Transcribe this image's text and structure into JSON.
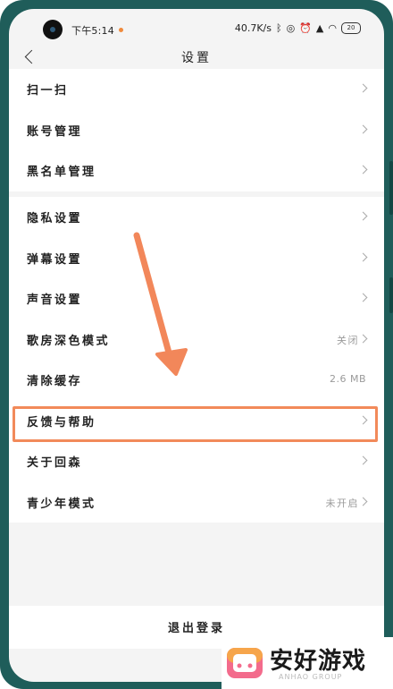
{
  "status_bar": {
    "time": "下午5:14",
    "network_speed": "40.7K/s",
    "icons": [
      "bluetooth-icon",
      "headset-icon",
      "alarm-icon",
      "cellular-signal-icon",
      "wifi-icon"
    ],
    "battery": "20"
  },
  "header": {
    "title": "设置"
  },
  "group1": [
    {
      "label": "扫一扫"
    },
    {
      "label": "账号管理"
    },
    {
      "label": "黑名单管理"
    }
  ],
  "group2": [
    {
      "label": "隐私设置"
    },
    {
      "label": "弹幕设置"
    },
    {
      "label": "声音设置"
    },
    {
      "label": "歌房深色模式",
      "value": "关闭"
    },
    {
      "label": "清除缓存",
      "value": "2.6 MB"
    },
    {
      "label": "反馈与帮助",
      "highlighted": true
    },
    {
      "label": "关于回森"
    },
    {
      "label": "青少年模式",
      "value": "未开启"
    }
  ],
  "logout": {
    "label": "退出登录"
  },
  "annotation": {
    "color": "#f2875a"
  },
  "watermark": {
    "text": "安好游戏",
    "sub": "ANHAO GROUP"
  },
  "colors": {
    "frame": "#1f5d5a",
    "background": "#f4f4f4",
    "highlight": "#f28a5a"
  }
}
